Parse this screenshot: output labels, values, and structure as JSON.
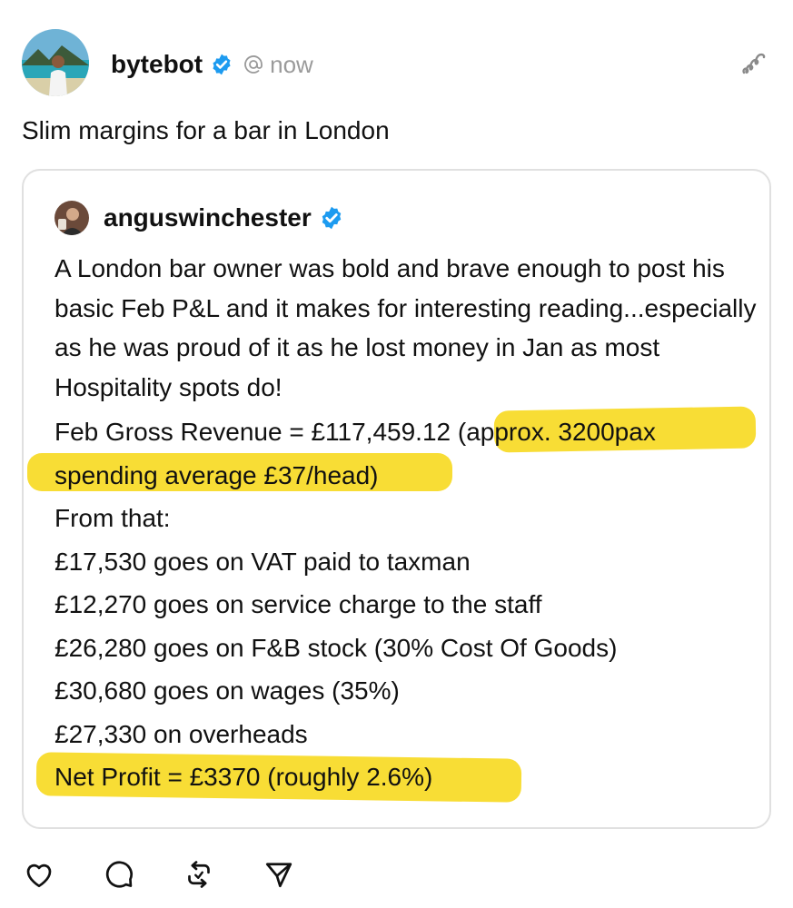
{
  "post": {
    "author": "bytebot",
    "timestamp": "now",
    "text": "Slim margins for a bar in London",
    "avatar_icon": "person-on-beach-avatar",
    "verified_icon": "verified-badge-icon",
    "more_icon": "more-squiggle-icon"
  },
  "quote": {
    "author": "anguswinchester",
    "intro": "A London bar owner was bold and brave enough to post his basic Feb P&L and it makes for interesting reading...especially as he was proud of it as he lost money in Jan as most Hospitality spots do!",
    "revenue_prefix": "Feb Gross Revenue = £117,459.12 ",
    "revenue_note_1": "(approx. 3200pax",
    "revenue_note_2": "spending average £37/head)",
    "lines": [
      "From that:",
      "£17,530 goes on VAT paid to taxman",
      "£12,270 goes on service charge to the staff",
      "£26,280 goes on F&B stock (30% Cost Of Goods)",
      "£30,680 goes on wages (35%)",
      "£27,330 on overheads"
    ],
    "net_profit": "Net Profit = £3370 (roughly 2.6%)"
  },
  "actions": [
    "like-icon",
    "comment-icon",
    "repost-icon",
    "share-icon"
  ],
  "colors": {
    "highlight": "#f8dd35",
    "verified": "#1d9bf0",
    "muted": "#9a9a9a",
    "card_border": "#e0e0e0"
  }
}
